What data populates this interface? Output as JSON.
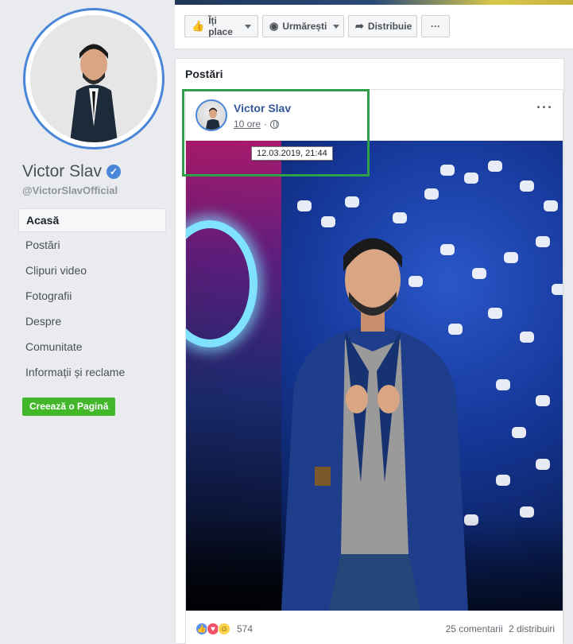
{
  "page": {
    "name": "Victor Slav",
    "handle": "@VictorSlavOfficial",
    "verified_icon": "verified-check-icon"
  },
  "nav": {
    "items": [
      {
        "label": "Acasă",
        "active": true
      },
      {
        "label": "Postări"
      },
      {
        "label": "Clipuri video"
      },
      {
        "label": "Fotografii"
      },
      {
        "label": "Despre"
      },
      {
        "label": "Comunitate"
      },
      {
        "label": "Informații și reclame"
      }
    ],
    "create_page": "Creează o Pagină"
  },
  "actions": {
    "like": "Îți place",
    "follow": "Urmărești",
    "share": "Distribuie",
    "more": "···"
  },
  "posts": {
    "title": "Postări",
    "post": {
      "author": "Victor Slav",
      "time": "10 ore",
      "separator": "·",
      "tooltip": "12.03.2019, 21:44",
      "more": "···",
      "reactions_count": "574",
      "comments": "25 comentarii",
      "shares": "2 distribuiri"
    }
  },
  "colors": {
    "accent": "#4a86d8",
    "link": "#365899",
    "highlight": "#2ea04a",
    "create_button": "#42b72a"
  }
}
